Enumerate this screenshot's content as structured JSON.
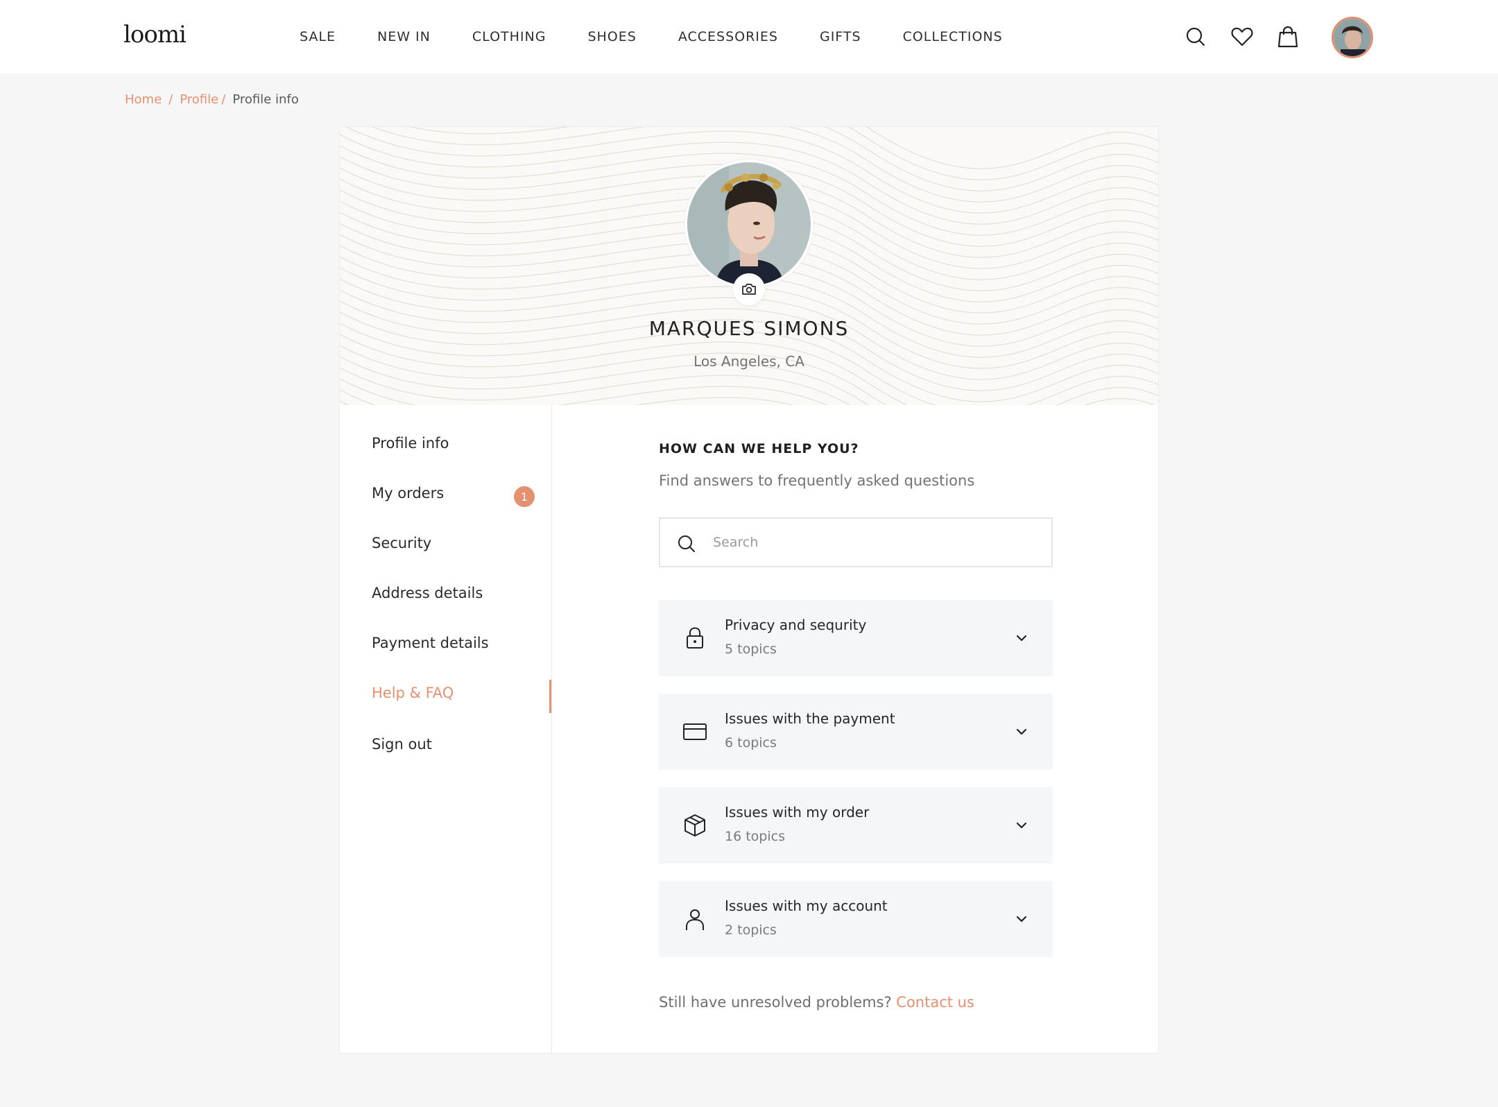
{
  "header": {
    "logo": "loomi",
    "nav": [
      "SALE",
      "NEW IN",
      "CLOTHING",
      "SHOES",
      "ACCESSORIES",
      "GIFTS",
      "COLLECTIONS"
    ],
    "icons": [
      "search-icon",
      "heart-icon",
      "shopping-bag-icon",
      "avatar"
    ]
  },
  "breadcrumb": {
    "home": "Home",
    "profile": "Profile",
    "sep": "/",
    "current": "Profile info"
  },
  "profile": {
    "name": "MARQUES SIMONS",
    "location": "Los Angeles, CA"
  },
  "sidebar": {
    "items": [
      {
        "label": "Profile info"
      },
      {
        "label": "My orders",
        "badge": "1"
      },
      {
        "label": "Security"
      },
      {
        "label": "Address details"
      },
      {
        "label": "Payment details"
      },
      {
        "label": "Help & FAQ",
        "active": true
      },
      {
        "label": "Sign out"
      }
    ]
  },
  "faq": {
    "title": "HOW CAN WE HELP YOU?",
    "subtitle": "Find answers to frequently asked questions",
    "search_placeholder": "Search",
    "topics": [
      {
        "title": "Privacy and sequrity",
        "count": "5 topics",
        "icon": "lock-icon"
      },
      {
        "title": "Issues with the payment",
        "count": "6 topics",
        "icon": "credit-card-icon"
      },
      {
        "title": "Issues with my order",
        "count": "16 topics",
        "icon": "box-icon"
      },
      {
        "title": "Issues with my account",
        "count": "2 topics",
        "icon": "user-icon"
      }
    ],
    "footer_text": "Still have unresolved problems?",
    "footer_link": "Contact us"
  },
  "colors": {
    "accent": "#e5916f",
    "background": "#f6f6f6",
    "topic_bg": "#f5f6f8"
  }
}
